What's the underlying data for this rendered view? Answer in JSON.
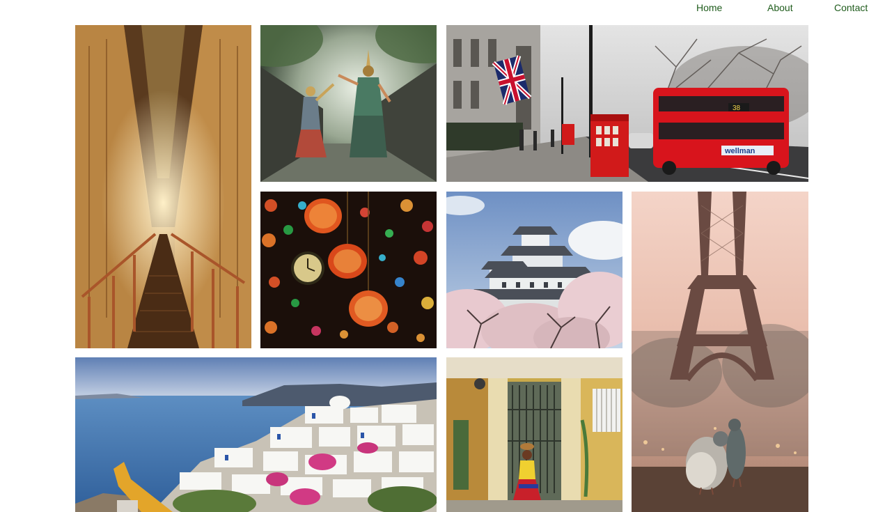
{
  "nav": {
    "home": "Home",
    "about": "About",
    "contact": "Contact"
  },
  "colors": {
    "nav_link": "#1f5c1c",
    "background": "#ffffff"
  },
  "gallery": {
    "images": [
      {
        "name": "egypt-tomb-corridor"
      },
      {
        "name": "thai-dancers"
      },
      {
        "name": "london-street-bus"
      },
      {
        "name": "turkish-lanterns"
      },
      {
        "name": "himeji-castle-blossoms"
      },
      {
        "name": "eiffel-tower-pigeons"
      },
      {
        "name": "santorini-coast"
      },
      {
        "name": "colorful-street-door"
      }
    ]
  },
  "london": {
    "bus_brand": "wellman",
    "bus_route": "38"
  }
}
